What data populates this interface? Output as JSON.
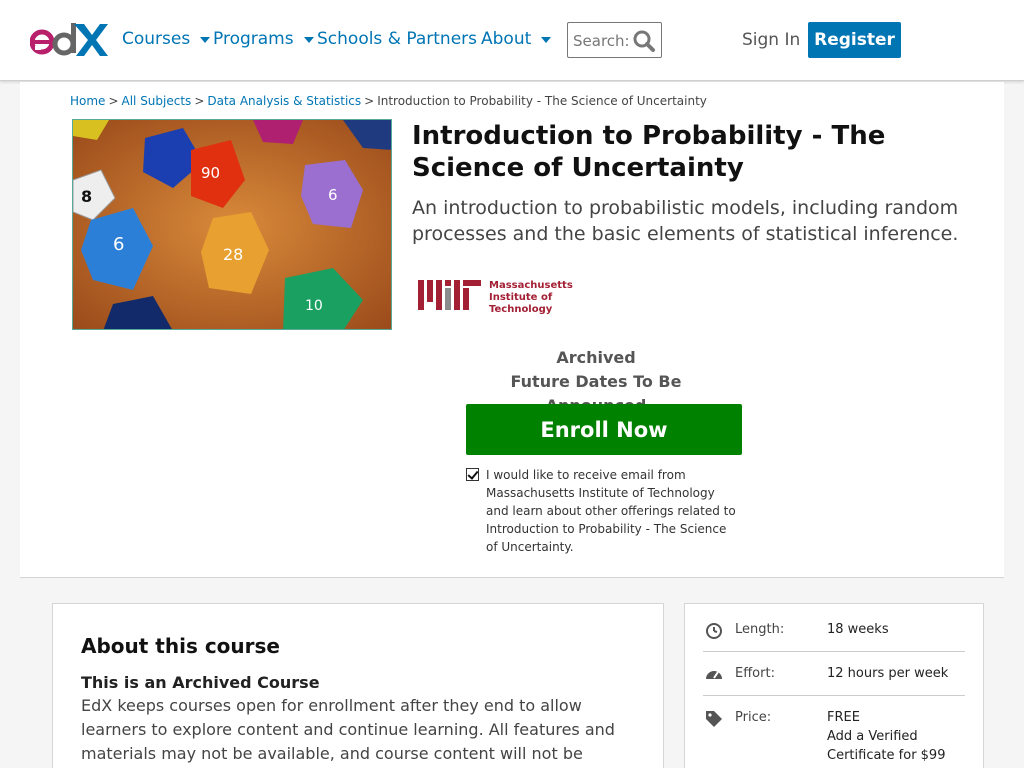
{
  "header": {
    "logo_text": "edX",
    "nav": [
      {
        "label": "Courses",
        "has_menu": true
      },
      {
        "label": "Programs",
        "has_menu": true
      },
      {
        "label": "Schools & Partners",
        "has_menu": false
      },
      {
        "label": "About",
        "has_menu": true
      }
    ],
    "search_placeholder": "Search:",
    "sign_in": "Sign In",
    "register": "Register"
  },
  "breadcrumb": {
    "items": [
      "Home",
      "All Subjects",
      "Data Analysis & Statistics"
    ],
    "separator": ">",
    "current": "Introduction to Probability - The Science of Uncertainty"
  },
  "course": {
    "title": "Introduction to Probability - The Science of Uncertainty",
    "subtitle": "An introduction to probabilistic models, including random processes and the basic elements of statistical inference.",
    "image_icon": "dice-image",
    "school_logo_text": "Massachusetts Institute of Technology",
    "status": "Archived",
    "dates": "Future Dates To Be Announced",
    "enroll_label": "Enroll Now",
    "consent_checked": true,
    "consent_text": "I would like to receive email from Massachusetts Institute of Technology and learn about other offerings related to Introduction to Probability - The Science of Uncertainty."
  },
  "about": {
    "heading": "About this course",
    "archived_heading": "This is an Archived Course",
    "body": "EdX keeps courses open for enrollment after they end to allow learners to explore content and continue learning. All features and materials may not be available, and course content will not be updated. Check back often to"
  },
  "facts": [
    {
      "icon": "clock-icon",
      "label": "Length:",
      "value": "18 weeks"
    },
    {
      "icon": "gauge-icon",
      "label": "Effort:",
      "value": "12 hours per week"
    },
    {
      "icon": "tag-icon",
      "label": "Price:",
      "value_lines": [
        "FREE",
        "Add a Verified",
        "Certificate for $99"
      ]
    }
  ],
  "colors": {
    "brand_blue": "#0075b4",
    "enroll_green": "#008100",
    "mit_red": "#a31f34"
  }
}
